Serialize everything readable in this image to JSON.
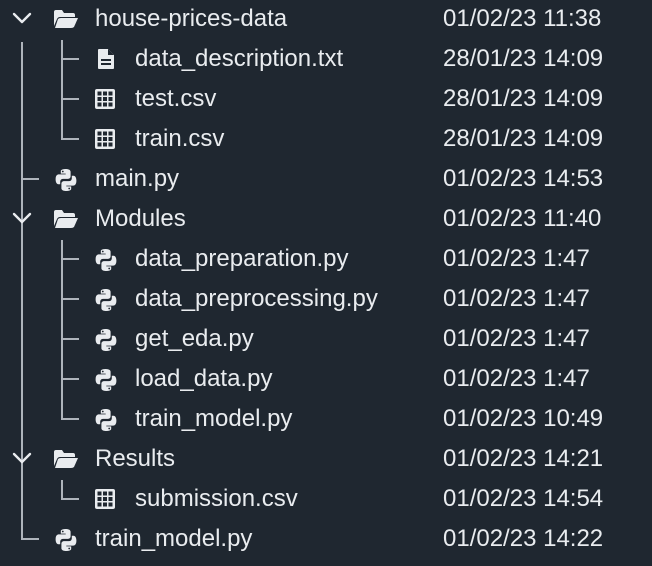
{
  "file_tree": {
    "items": [
      {
        "name": "house-prices-data",
        "modified": "01/02/23 11:38",
        "icon": "folder-open-icon"
      },
      {
        "name": "data_description.txt",
        "modified": "28/01/23 14:09",
        "icon": "text-file-icon"
      },
      {
        "name": "test.csv",
        "modified": "28/01/23 14:09",
        "icon": "table-icon"
      },
      {
        "name": "train.csv",
        "modified": "28/01/23 14:09",
        "icon": "table-icon"
      },
      {
        "name": "main.py",
        "modified": "01/02/23 14:53",
        "icon": "python-icon"
      },
      {
        "name": "Modules",
        "modified": "01/02/23 11:40",
        "icon": "folder-open-icon"
      },
      {
        "name": "data_preparation.py",
        "modified": "01/02/23 1:47",
        "icon": "python-icon"
      },
      {
        "name": "data_preprocessing.py",
        "modified": "01/02/23 1:47",
        "icon": "python-icon"
      },
      {
        "name": "get_eda.py",
        "modified": "01/02/23 1:47",
        "icon": "python-icon"
      },
      {
        "name": "load_data.py",
        "modified": "01/02/23 1:47",
        "icon": "python-icon"
      },
      {
        "name": "train_model.py",
        "modified": "01/02/23 10:49",
        "icon": "python-icon"
      },
      {
        "name": "Results",
        "modified": "01/02/23 14:21",
        "icon": "folder-open-icon"
      },
      {
        "name": "submission.csv",
        "modified": "01/02/23 14:54",
        "icon": "table-icon"
      },
      {
        "name": "train_model.py",
        "modified": "01/02/23 14:22",
        "icon": "python-icon"
      }
    ]
  }
}
